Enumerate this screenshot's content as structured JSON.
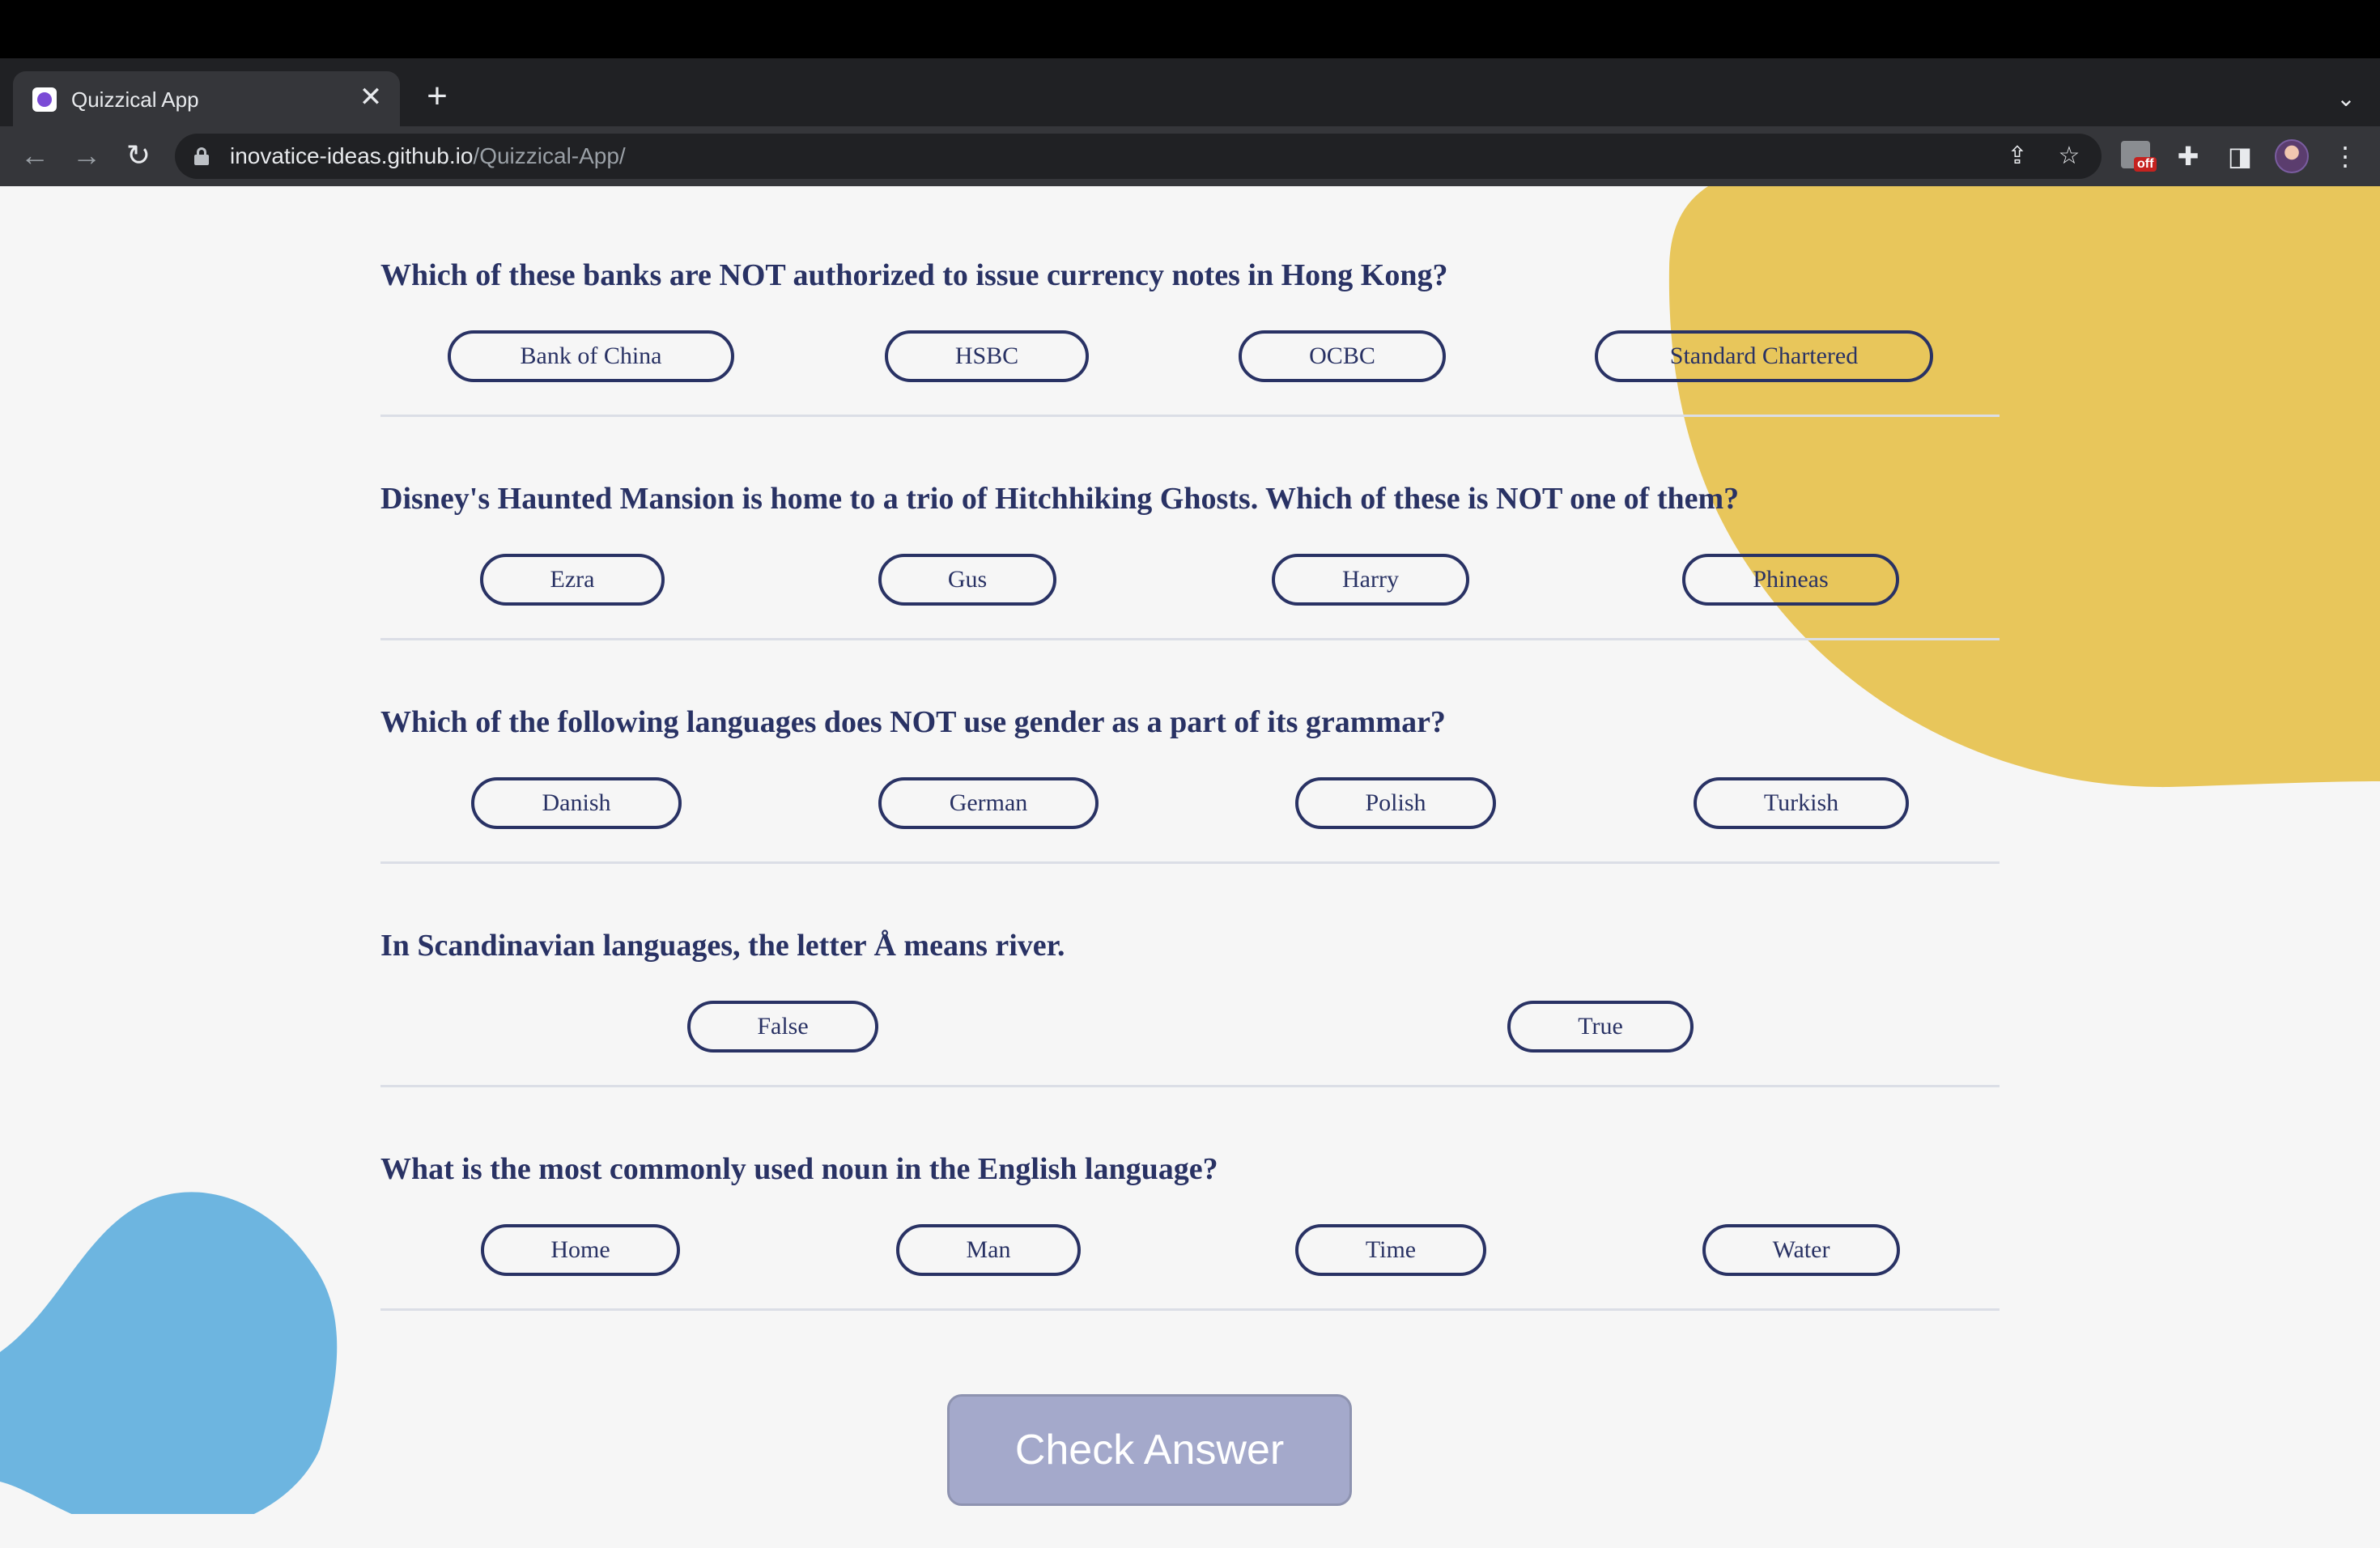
{
  "browser": {
    "tab_title": "Quizzical App",
    "close_glyph": "✕",
    "new_tab_glyph": "+",
    "tab_search_glyph": "⌄",
    "back_glyph": "←",
    "forward_glyph": "→",
    "reload_glyph": "↻",
    "url_host": "inovatice-ideas.github.io",
    "url_path": "/Quizzical-App/",
    "share_glyph": "⇪",
    "bookmark_glyph": "☆",
    "extension_badge": "off",
    "puzzle_glyph": "✚",
    "sidepanel_glyph": "◨",
    "menu_glyph": "⋮"
  },
  "colors": {
    "text": "#293264",
    "background": "#f6f6f6",
    "yellow_blob": "#e8c65b",
    "blue_blob": "#6db5e0",
    "check_button": "#a4a9cb"
  },
  "questions": [
    {
      "text": "Which of these banks are NOT authorized to issue currency notes in Hong Kong?",
      "answers": [
        "Bank of China",
        "HSBC",
        "OCBC",
        "Standard Chartered"
      ]
    },
    {
      "text": "Disney's Haunted Mansion is home to a trio of Hitchhiking Ghosts. Which of these is NOT one of them?",
      "answers": [
        "Ezra",
        "Gus",
        "Harry",
        "Phineas"
      ]
    },
    {
      "text": "Which of the following languages does NOT use gender as a part of its grammar?",
      "answers": [
        "Danish",
        "German",
        "Polish",
        "Turkish"
      ]
    },
    {
      "text": "In Scandinavian languages, the letter Å means river.",
      "answers": [
        "False",
        "True"
      ]
    },
    {
      "text": "What is the most commonly used noun in the English language?",
      "answers": [
        "Home",
        "Man",
        "Time",
        "Water"
      ]
    }
  ],
  "check_button_label": "Check Answer"
}
